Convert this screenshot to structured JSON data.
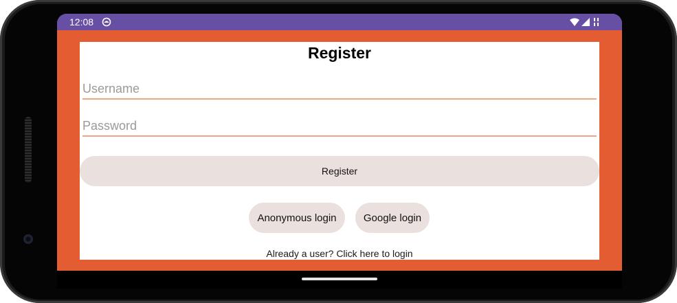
{
  "status_bar": {
    "time": "12:08",
    "color": "#6750a4",
    "icons": [
      "notification-icon",
      "wifi-icon",
      "cell-signal-icon",
      "no-data-icon"
    ]
  },
  "theme": {
    "background": "#e45c32",
    "card": "#ffffff",
    "button": "#eae0dd",
    "underline": "#f2a487"
  },
  "form": {
    "title": "Register",
    "username_placeholder": "Username",
    "username_value": "",
    "password_placeholder": "Password",
    "password_value": "",
    "register_button": "Register",
    "anonymous_login_button": "Anonymous login",
    "google_login_button": "Google login",
    "login_link": "Already a user? Click here to login"
  }
}
